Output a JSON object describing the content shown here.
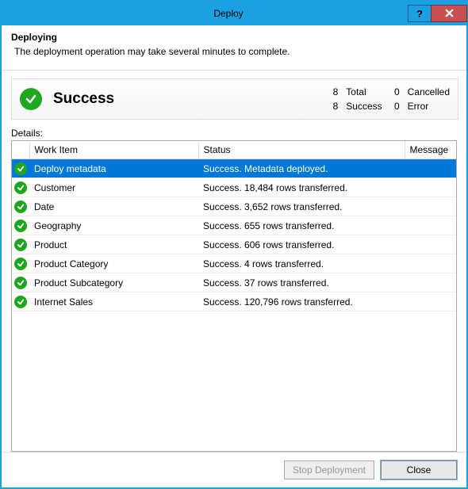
{
  "window": {
    "title": "Deploy"
  },
  "header": {
    "title": "Deploying",
    "subtitle": "The deployment operation may take several minutes to complete."
  },
  "summary": {
    "status_label": "Success",
    "stats": {
      "total": 8,
      "total_label": "Total",
      "cancelled": 0,
      "cancelled_label": "Cancelled",
      "success": 8,
      "success_label": "Success",
      "error": 0,
      "error_label": "Error"
    }
  },
  "details_label": "Details:",
  "columns": {
    "icon": "",
    "work_item": "Work Item",
    "status": "Status",
    "message": "Message"
  },
  "rows": [
    {
      "ok": true,
      "selected": true,
      "work_item": "Deploy metadata",
      "status": "Success. Metadata deployed.",
      "message": ""
    },
    {
      "ok": true,
      "selected": false,
      "work_item": "Customer",
      "status": "Success. 18,484 rows transferred.",
      "message": ""
    },
    {
      "ok": true,
      "selected": false,
      "work_item": "Date",
      "status": "Success. 3,652 rows transferred.",
      "message": ""
    },
    {
      "ok": true,
      "selected": false,
      "work_item": "Geography",
      "status": "Success. 655 rows transferred.",
      "message": ""
    },
    {
      "ok": true,
      "selected": false,
      "work_item": "Product",
      "status": "Success. 606 rows transferred.",
      "message": ""
    },
    {
      "ok": true,
      "selected": false,
      "work_item": "Product Category",
      "status": "Success. 4 rows transferred.",
      "message": ""
    },
    {
      "ok": true,
      "selected": false,
      "work_item": "Product Subcategory",
      "status": "Success. 37 rows transferred.",
      "message": ""
    },
    {
      "ok": true,
      "selected": false,
      "work_item": "Internet Sales",
      "status": "Success. 120,796 rows transferred.",
      "message": ""
    }
  ],
  "footer": {
    "stop": "Stop Deployment",
    "close": "Close"
  }
}
